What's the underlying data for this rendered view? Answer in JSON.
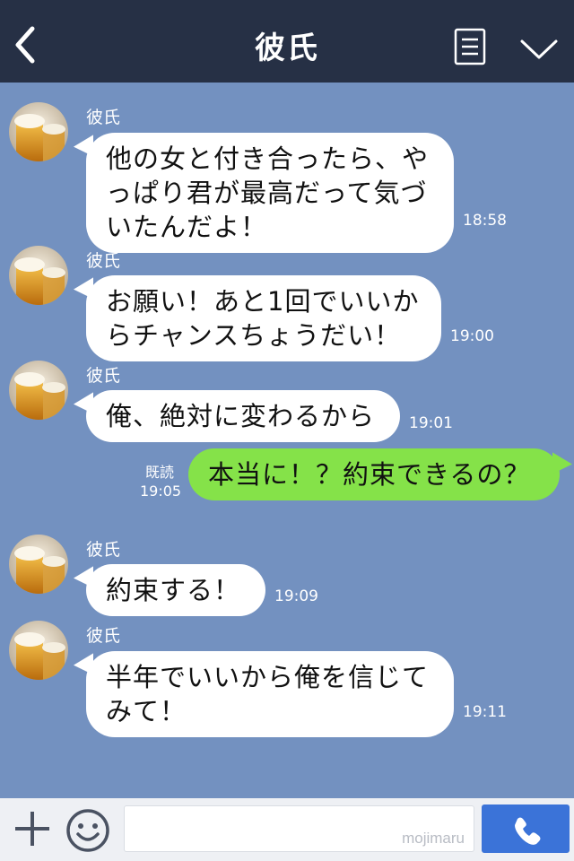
{
  "header": {
    "title": "彼氏",
    "back_icon": "chevron-left-icon",
    "menu_icon": "notes-icon",
    "more_icon": "chevron-down-icon"
  },
  "messages": [
    {
      "sender": "彼氏",
      "text": "他の女と付き合ったら、や\nっぱり君が最高だって気づ\nいたんだよ！",
      "time": "18:58"
    },
    {
      "sender": "彼氏",
      "text": "お願い！あと1回でいいか\nらチャンスちょうだい！",
      "time": "19:00"
    },
    {
      "sender": "彼氏",
      "text": "俺、絶対に変わるから",
      "time": "19:01"
    },
    {
      "text": "本当に！？約束できるの？",
      "read": "既読",
      "time": "19:05"
    },
    {
      "sender": "彼氏",
      "text": "約束する！",
      "time": "19:09"
    },
    {
      "sender": "彼氏",
      "text": "半年でいいから俺を信じて\nみて！",
      "time": "19:11"
    }
  ],
  "footer": {
    "watermark": "mojimaru",
    "plus_icon": "plus-icon",
    "sticker_icon": "smiley-icon",
    "call_icon": "phone-icon"
  },
  "colors": {
    "header_bg": "#263045",
    "chat_bg": "#7391c0",
    "incoming_bubble": "#ffffff",
    "outgoing_bubble": "#85e249",
    "call_button": "#3b73d8"
  }
}
